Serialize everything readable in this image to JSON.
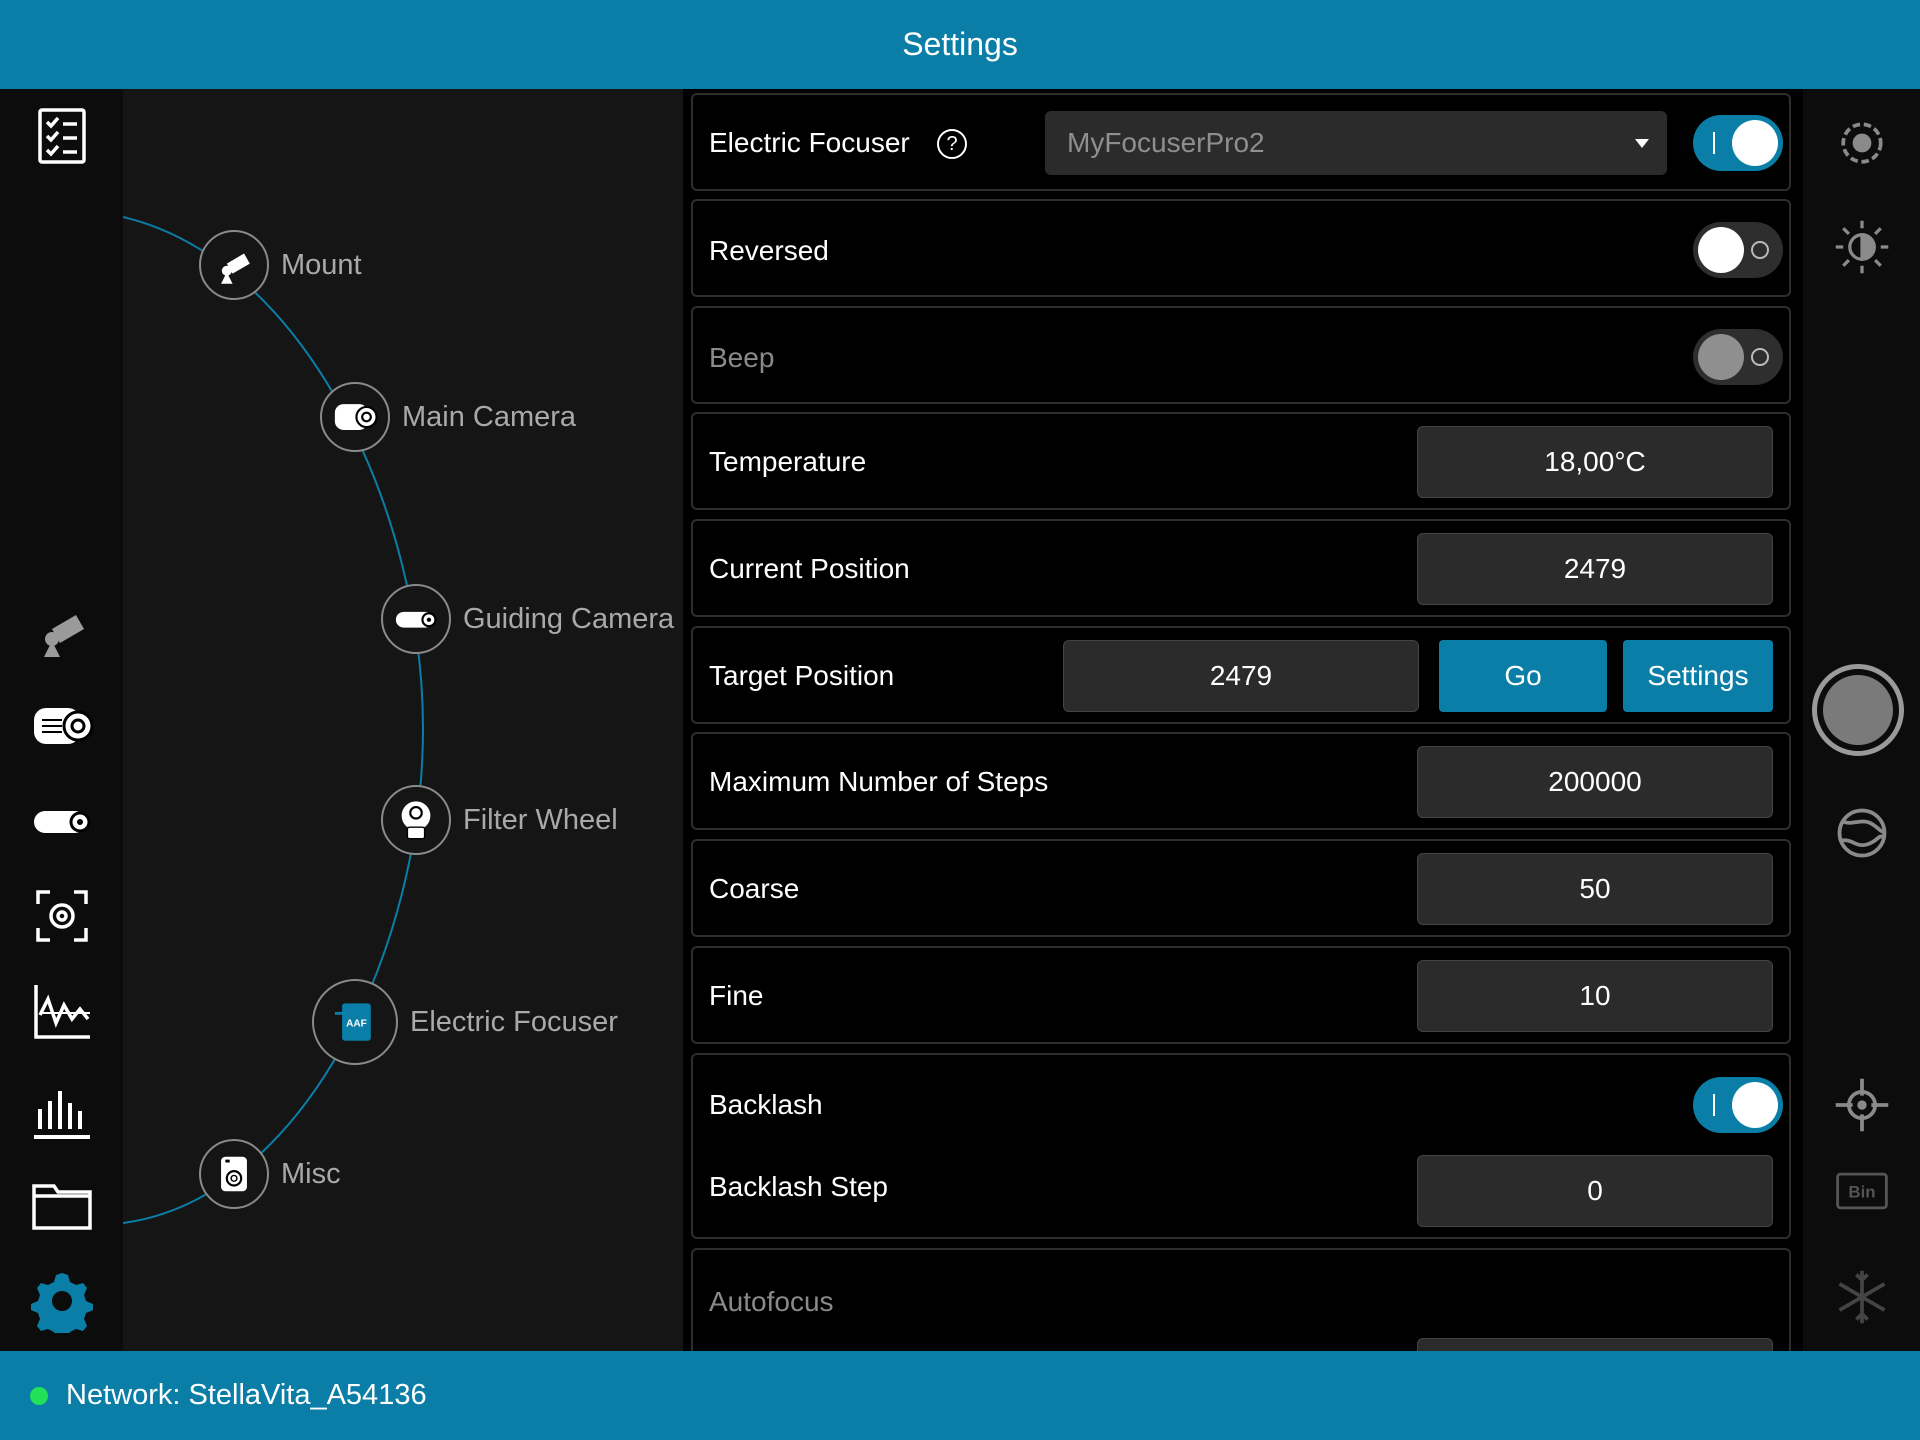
{
  "header": {
    "title": "Settings"
  },
  "footer": {
    "network_label": "Network: StellaVita_A54136",
    "status_color": "#22e05a"
  },
  "accent_color": "#0a7ea7",
  "left_nav": [
    {
      "icon": "checklist-icon"
    },
    {
      "icon": "mount-icon"
    },
    {
      "icon": "main-camera-icon"
    },
    {
      "icon": "guiding-camera-icon"
    },
    {
      "icon": "focus-frame-icon"
    },
    {
      "icon": "graph-icon"
    },
    {
      "icon": "histogram-icon"
    },
    {
      "icon": "folder-icon"
    },
    {
      "icon": "gear-icon"
    }
  ],
  "device_tree": [
    {
      "label": "Mount",
      "icon": "mount-icon"
    },
    {
      "label": "Main Camera",
      "icon": "main-camera-icon"
    },
    {
      "label": "Guiding Camera",
      "icon": "guiding-camera-icon"
    },
    {
      "label": "Filter Wheel",
      "icon": "filter-wheel-icon"
    },
    {
      "label": "Electric Focuser",
      "icon": "focuser-icon",
      "badge": "AAF"
    },
    {
      "label": "Misc",
      "icon": "misc-icon"
    }
  ],
  "settings": {
    "electric_focuser": {
      "label": "Electric Focuser",
      "help": "?",
      "selected": "MyFocuserPro2",
      "enabled": true
    },
    "reversed": {
      "label": "Reversed",
      "enabled": false
    },
    "beep": {
      "label": "Beep",
      "enabled": false,
      "disabled": true
    },
    "temperature": {
      "label": "Temperature",
      "value": "18,00°C"
    },
    "current_position": {
      "label": "Current Position",
      "value": "2479"
    },
    "target_position": {
      "label": "Target Position",
      "value": "2479",
      "go_label": "Go",
      "settings_label": "Settings"
    },
    "max_steps": {
      "label": "Maximum Number of Steps",
      "value": "200000"
    },
    "coarse": {
      "label": "Coarse",
      "value": "50"
    },
    "fine": {
      "label": "Fine",
      "value": "10"
    },
    "backlash": {
      "label": "Backlash",
      "enabled": true,
      "step_label": "Backlash Step",
      "step_value": "0"
    },
    "autofocus": {
      "label": "Autofocus"
    }
  },
  "right_bar": [
    {
      "icon": "exposure-dial-icon"
    },
    {
      "icon": "brightness-icon"
    },
    {
      "icon": "shutter-button"
    },
    {
      "icon": "globe-icon"
    },
    {
      "icon": "crosshair-icon"
    },
    {
      "icon": "bin-icon",
      "label": "Bin"
    },
    {
      "icon": "snowflake-icon"
    }
  ]
}
